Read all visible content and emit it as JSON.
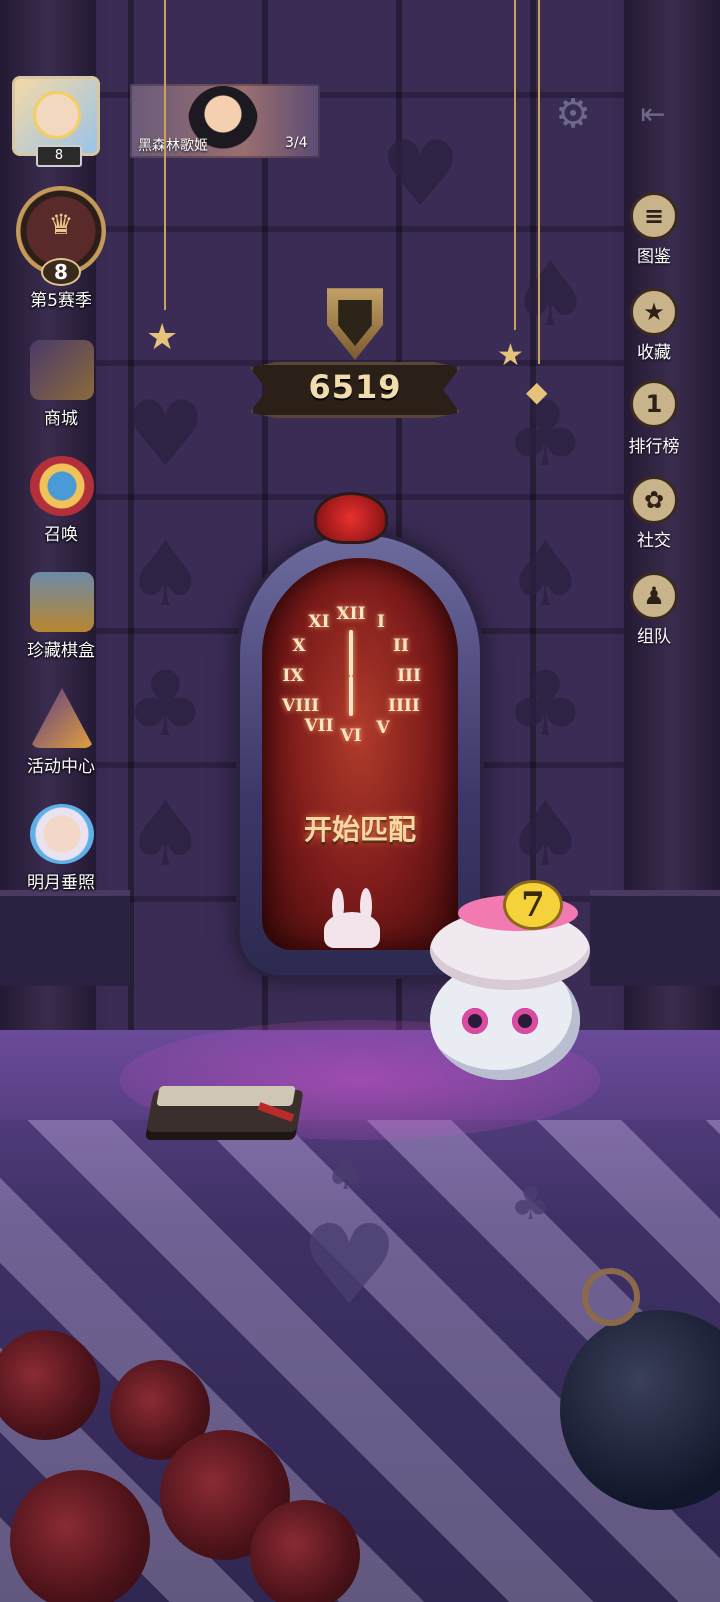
{
  "player": {
    "level": "8"
  },
  "mission": {
    "title": "黑森林歌姬",
    "progress": "3/4"
  },
  "season": {
    "number": "8",
    "label": "第5赛季"
  },
  "left_menu": [
    {
      "label": "商城",
      "icon": "shop-icon"
    },
    {
      "label": "召唤",
      "icon": "summon-icon"
    },
    {
      "label": "珍藏棋盒",
      "icon": "chess-box-icon"
    },
    {
      "label": "活动中心",
      "icon": "event-center-icon"
    },
    {
      "label": "明月垂照",
      "icon": "moon-event-icon"
    }
  ],
  "right_menu": [
    {
      "label": "图鉴",
      "icon": "book-icon"
    },
    {
      "label": "收藏",
      "icon": "collection-icon"
    },
    {
      "label": "排行榜",
      "icon": "leaderboard-icon",
      "badge": "1"
    },
    {
      "label": "社交",
      "icon": "social-icon"
    },
    {
      "label": "组队",
      "icon": "team-icon"
    }
  ],
  "trophy": {
    "score": "6519"
  },
  "match": {
    "label": "开始匹配"
  },
  "clock": {
    "numerals": [
      "XII",
      "I",
      "II",
      "III",
      "IIII",
      "V",
      "VI",
      "VII",
      "VIII",
      "IX",
      "X",
      "XI"
    ]
  },
  "pet": {
    "badge": "7"
  },
  "colors": {
    "accent_gold": "#e6c27a",
    "mirror_red": "#b13b2b",
    "wall_purple": "#3b2c55"
  }
}
